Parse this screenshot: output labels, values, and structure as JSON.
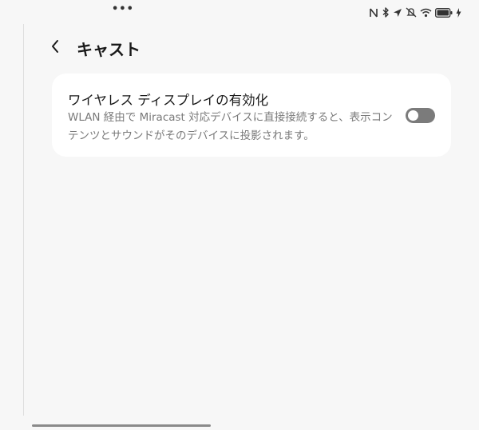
{
  "status_bar": {
    "menu_dots": "•••",
    "icons": [
      "nfc-icon",
      "bluetooth-icon",
      "location-icon",
      "mute-icon",
      "wifi-icon",
      "battery-icon",
      "charging-icon"
    ]
  },
  "header": {
    "back_icon": "chevron-left-icon",
    "title": "キャスト"
  },
  "wireless_display": {
    "title": "ワイヤレス ディスプレイの有効化",
    "description": "WLAN 経由で Miracast 対応デバイスに直接接続すると、表示コンテンツとサウンドがそのデバイスに投影されます。",
    "enabled": false
  },
  "colors": {
    "background": "#f7f7f7",
    "card": "#ffffff",
    "toggle_off": "#7b7b7b",
    "description_text": "#7a7a7a"
  }
}
